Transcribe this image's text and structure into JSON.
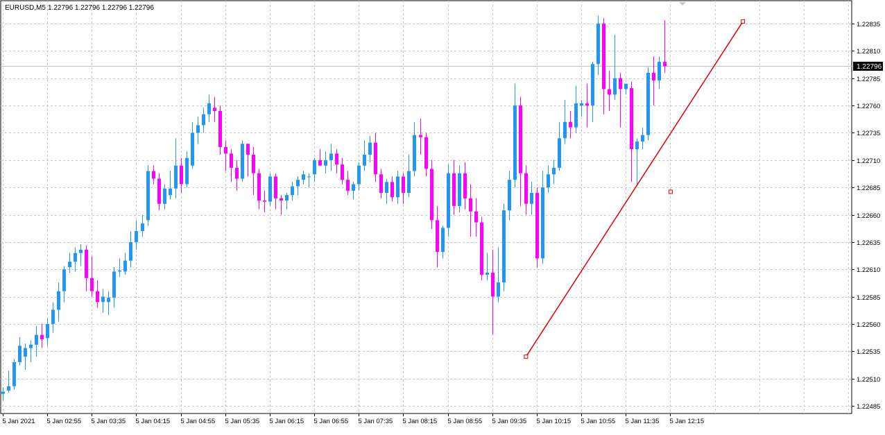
{
  "header": {
    "symbol": "EURUSD,M5",
    "ohlc": "1.22796 1.22796 1.22796 1.22796"
  },
  "colors": {
    "bull": "#2196f3",
    "bear": "#ff00ff",
    "grid": "#c8c8c8",
    "trendline": "#e00000",
    "background": "#ffffff",
    "price_tag_bg": "#000000",
    "price_tag_fg": "#ffffff",
    "text": "#000000"
  },
  "chart_data": {
    "type": "candlestick",
    "symbol": "EURUSD",
    "timeframe": "M5",
    "ylim": [
      1.22478,
      1.22856
    ],
    "y_ticks": [
      "1.22835",
      "1.22810",
      "1.22785",
      "1.22760",
      "1.22735",
      "1.22710",
      "1.22685",
      "1.22660",
      "1.22635",
      "1.22610",
      "1.22585",
      "1.22560",
      "1.22535",
      "1.22510",
      "1.22485"
    ],
    "x_tick_labels": [
      "5 Jan 2021",
      "5 Jan 02:55",
      "5 Jan 03:35",
      "5 Jan 04:15",
      "5 Jan 04:55",
      "5 Jan 05:35",
      "5 Jan 06:15",
      "5 Jan 06:55",
      "5 Jan 07:35",
      "5 Jan 08:15",
      "5 Jan 08:55",
      "5 Jan 09:35",
      "5 Jan 10:15",
      "5 Jan 10:55",
      "5 Jan 11:35",
      "5 Jan 12:15"
    ],
    "last_price": "1.22796",
    "grid": true,
    "candles": [
      [
        1.22496,
        1.22502,
        1.2249,
        1.22498
      ],
      [
        1.22499,
        1.22517,
        1.22497,
        1.22503
      ],
      [
        1.22503,
        1.22528,
        1.225,
        1.22525
      ],
      [
        1.22525,
        1.22548,
        1.22522,
        1.2254
      ],
      [
        1.2253,
        1.22542,
        1.22518,
        1.22538
      ],
      [
        1.22538,
        1.22545,
        1.22525,
        1.22541
      ],
      [
        1.22541,
        1.22558,
        1.2253,
        1.2255
      ],
      [
        1.2255,
        1.2256,
        1.22538,
        1.22546
      ],
      [
        1.22547,
        1.22565,
        1.2254,
        1.2256
      ],
      [
        1.2256,
        1.2258,
        1.22552,
        1.22573
      ],
      [
        1.22573,
        1.22598,
        1.22562,
        1.2259
      ],
      [
        1.2259,
        1.22613,
        1.2258,
        1.2261
      ],
      [
        1.22612,
        1.22625,
        1.22607,
        1.22617
      ],
      [
        1.22617,
        1.2263,
        1.22608,
        1.22625
      ],
      [
        1.22625,
        1.22633,
        1.22613,
        1.22628
      ],
      [
        1.22628,
        1.22632,
        1.2259,
        1.22602
      ],
      [
        1.22602,
        1.22622,
        1.22585,
        1.2259
      ],
      [
        1.2259,
        1.226,
        1.22575,
        1.2258
      ],
      [
        1.2258,
        1.22592,
        1.2257,
        1.22585
      ],
      [
        1.2258,
        1.2259,
        1.22568,
        1.22584
      ],
      [
        1.22584,
        1.22612,
        1.22575,
        1.22608
      ],
      [
        1.22608,
        1.2262,
        1.22603,
        1.22609
      ],
      [
        1.22608,
        1.22625,
        1.22605,
        1.22618
      ],
      [
        1.22618,
        1.22645,
        1.22612,
        1.22635
      ],
      [
        1.22635,
        1.22655,
        1.22628,
        1.22645
      ],
      [
        1.22645,
        1.2266,
        1.2264,
        1.22652
      ],
      [
        1.22655,
        1.22705,
        1.2265,
        1.227
      ],
      [
        1.227,
        1.22705,
        1.22688,
        1.22693
      ],
      [
        1.22693,
        1.22698,
        1.22664,
        1.2267
      ],
      [
        1.2267,
        1.22688,
        1.22665,
        1.22684
      ],
      [
        1.22678,
        1.227,
        1.22674,
        1.22684
      ],
      [
        1.22684,
        1.2273,
        1.22675,
        1.22705
      ],
      [
        1.22705,
        1.22712,
        1.2268,
        1.22688
      ],
      [
        1.22688,
        1.22718,
        1.22685,
        1.22712
      ],
      [
        1.22705,
        1.22745,
        1.22702,
        1.22735
      ],
      [
        1.22735,
        1.2275,
        1.22725,
        1.22742
      ],
      [
        1.22742,
        1.22758,
        1.22735,
        1.22752
      ],
      [
        1.22752,
        1.2277,
        1.22745,
        1.22762
      ],
      [
        1.22758,
        1.22768,
        1.22745,
        1.22755
      ],
      [
        1.22755,
        1.2276,
        1.22715,
        1.22722
      ],
      [
        1.22722,
        1.22728,
        1.227,
        1.22716
      ],
      [
        1.22716,
        1.2272,
        1.2269,
        1.22703
      ],
      [
        1.22703,
        1.2271,
        1.22682,
        1.22693
      ],
      [
        1.22693,
        1.22728,
        1.2269,
        1.22725
      ],
      [
        1.22725,
        1.22725,
        1.22695,
        1.22715
      ],
      [
        1.22715,
        1.22722,
        1.22678,
        1.22698
      ],
      [
        1.22698,
        1.22702,
        1.22665,
        1.22673
      ],
      [
        1.22673,
        1.22682,
        1.22662,
        1.22672
      ],
      [
        1.22672,
        1.22698,
        1.22668,
        1.22695
      ],
      [
        1.22695,
        1.22698,
        1.22665,
        1.22675
      ],
      [
        1.22675,
        1.22678,
        1.2266,
        1.22673
      ],
      [
        1.22673,
        1.2268,
        1.22665,
        1.22678
      ],
      [
        1.22678,
        1.2269,
        1.22673,
        1.22686
      ],
      [
        1.22686,
        1.22695,
        1.22678,
        1.22692
      ],
      [
        1.22692,
        1.227,
        1.22688,
        1.22697
      ],
      [
        1.22695,
        1.22698,
        1.22685,
        1.22695
      ],
      [
        1.22697,
        1.22712,
        1.2269,
        1.2271
      ],
      [
        1.2271,
        1.2272,
        1.22705,
        1.22705
      ],
      [
        1.22705,
        1.22718,
        1.22698,
        1.2271
      ],
      [
        1.2271,
        1.22725,
        1.227,
        1.22716
      ],
      [
        1.22716,
        1.2272,
        1.22698,
        1.22706
      ],
      [
        1.22706,
        1.22712,
        1.22688,
        1.22692
      ],
      [
        1.22692,
        1.227,
        1.22678,
        1.22682
      ],
      [
        1.22682,
        1.2269,
        1.22674,
        1.22688
      ],
      [
        1.22688,
        1.22708,
        1.22682,
        1.22705
      ],
      [
        1.22705,
        1.22728,
        1.227,
        1.22715
      ],
      [
        1.22715,
        1.22732,
        1.22708,
        1.22726
      ],
      [
        1.22726,
        1.22735,
        1.2269,
        1.22697
      ],
      [
        1.22697,
        1.22702,
        1.22675,
        1.2268
      ],
      [
        1.2268,
        1.22693,
        1.2267,
        1.2269
      ],
      [
        1.2269,
        1.22695,
        1.22672,
        1.22676
      ],
      [
        1.22676,
        1.227,
        1.2267,
        1.22695
      ],
      [
        1.22695,
        1.22698,
        1.2267,
        1.2268
      ],
      [
        1.2268,
        1.22715,
        1.22676,
        1.227
      ],
      [
        1.227,
        1.22745,
        1.22695,
        1.22733
      ],
      [
        1.22733,
        1.22748,
        1.22715,
        1.22731
      ],
      [
        1.22731,
        1.22735,
        1.22695,
        1.22702
      ],
      [
        1.22702,
        1.2271,
        1.22647,
        1.22655
      ],
      [
        1.22655,
        1.22668,
        1.22612,
        1.22626
      ],
      [
        1.22626,
        1.2265,
        1.2262,
        1.22648
      ],
      [
        1.22648,
        1.22706,
        1.2264,
        1.22698
      ],
      [
        1.22698,
        1.2271,
        1.2266,
        1.22668
      ],
      [
        1.22668,
        1.22705,
        1.22662,
        1.22698
      ],
      [
        1.22698,
        1.22708,
        1.22665,
        1.22675
      ],
      [
        1.22675,
        1.22688,
        1.2264,
        1.22663
      ],
      [
        1.22663,
        1.22675,
        1.2264,
        1.22653
      ],
      [
        1.22653,
        1.22658,
        1.226,
        1.22605
      ],
      [
        1.22605,
        1.22625,
        1.226,
        1.22607
      ],
      [
        1.22607,
        1.22628,
        1.2255,
        1.22585
      ],
      [
        1.22585,
        1.2263,
        1.2258,
        1.22598
      ],
      [
        1.22598,
        1.2267,
        1.2259,
        1.22664
      ],
      [
        1.22664,
        1.227,
        1.22655,
        1.22692
      ],
      [
        1.22692,
        1.2278,
        1.22685,
        1.2276
      ],
      [
        1.2276,
        1.22768,
        1.22668,
        1.22698
      ],
      [
        1.22698,
        1.22705,
        1.2266,
        1.2267
      ],
      [
        1.2267,
        1.2269,
        1.2266,
        1.2268
      ],
      [
        1.2268,
        1.22685,
        1.22612,
        1.2262
      ],
      [
        1.2262,
        1.227,
        1.22615,
        1.22685
      ],
      [
        1.22685,
        1.22705,
        1.2268,
        1.22697
      ],
      [
        1.22697,
        1.2271,
        1.22688,
        1.22703
      ],
      [
        1.22703,
        1.22745,
        1.227,
        1.2273
      ],
      [
        1.2273,
        1.22765,
        1.22725,
        1.22745
      ],
      [
        1.22745,
        1.22755,
        1.2273,
        1.2274
      ],
      [
        1.2274,
        1.22778,
        1.22735,
        1.22762
      ],
      [
        1.2276,
        1.22765,
        1.2275,
        1.22762
      ],
      [
        1.22762,
        1.2278,
        1.2274,
        1.2276
      ],
      [
        1.2276,
        1.228,
        1.22745,
        1.22798
      ],
      [
        1.22798,
        1.22842,
        1.22788,
        1.22835
      ],
      [
        1.22835,
        1.2284,
        1.22752,
        1.22775
      ],
      [
        1.22775,
        1.22792,
        1.22755,
        1.2277
      ],
      [
        1.2277,
        1.22825,
        1.22765,
        1.22785
      ],
      [
        1.22785,
        1.2279,
        1.2274,
        1.22775
      ],
      [
        1.22775,
        1.2278,
        1.2277,
        1.2278
      ],
      [
        1.22776,
        1.22782,
        1.2269,
        1.2272
      ],
      [
        1.2272,
        1.2273,
        1.22688,
        1.22727
      ],
      [
        1.22727,
        1.2274,
        1.2272,
        1.22733
      ],
      [
        1.22733,
        1.22795,
        1.22728,
        1.2279
      ],
      [
        1.2279,
        1.22805,
        1.2276,
        1.22783
      ],
      [
        1.22783,
        1.22805,
        1.22775,
        1.228
      ],
      [
        1.228,
        1.22838,
        1.2279,
        1.22796
      ]
    ],
    "trendline": {
      "points": [
        {
          "time": "5 Jan 10:05",
          "price": 1.2253
        },
        {
          "time": "5 Jan 12:15",
          "price": 1.22681
        },
        {
          "time": "5 Jan 13:20",
          "price": 1.22837
        }
      ]
    }
  }
}
